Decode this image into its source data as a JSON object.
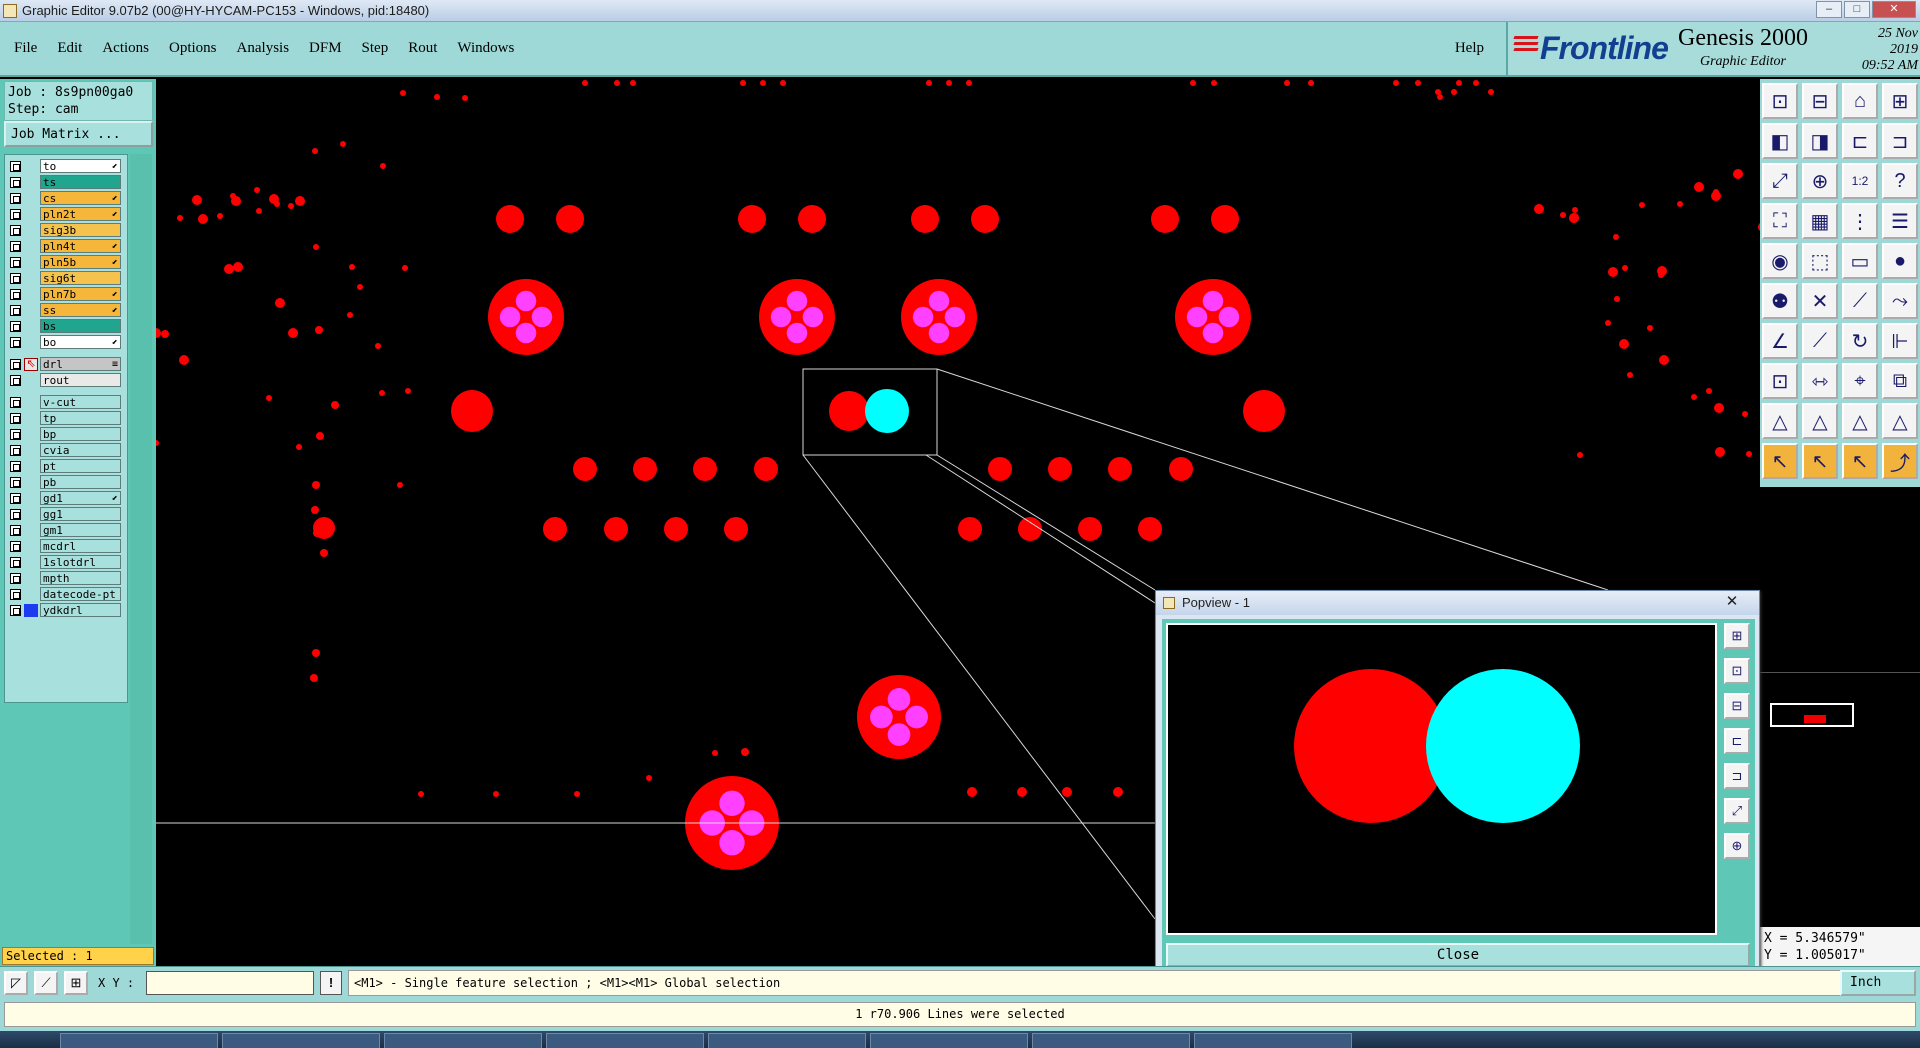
{
  "window": {
    "title": "Graphic Editor 9.07b2 (00@HY-HYCAM-PC153 - Windows, pid:18480)",
    "minimize": "–",
    "maximize": "□",
    "close": "✕"
  },
  "menu": {
    "items": [
      "File",
      "Edit",
      "Actions",
      "Options",
      "Analysis",
      "DFM",
      "Step",
      "Rout",
      "Windows"
    ],
    "help": "Help"
  },
  "brand": {
    "logo": "Frontline",
    "product": "Genesis 2000",
    "subproduct": "Graphic Editor",
    "date": "25 Nov 2019",
    "time": "09:52 AM"
  },
  "job": {
    "job_line": "Job : 8s9pn00ga0",
    "step_line": "Step: cam",
    "matrix_button": "Job Matrix ..."
  },
  "layers": [
    {
      "name": "to",
      "color": "#ffffff",
      "mark": "⬋"
    },
    {
      "name": "ts",
      "color": "#20a58e",
      "mark": ""
    },
    {
      "name": "cs",
      "color": "#f5b63a",
      "mark": "⬋"
    },
    {
      "name": "pln2t",
      "color": "#f5b63a",
      "mark": "⬋"
    },
    {
      "name": "sig3b",
      "color": "#f5c24e",
      "mark": ""
    },
    {
      "name": "pln4t",
      "color": "#f5b63a",
      "mark": "⬋"
    },
    {
      "name": "pln5b",
      "color": "#f5b63a",
      "mark": "⬋"
    },
    {
      "name": "sig6t",
      "color": "#f5c24e",
      "mark": ""
    },
    {
      "name": "pln7b",
      "color": "#f5b63a",
      "mark": "⬋"
    },
    {
      "name": "ss",
      "color": "#f5b63a",
      "mark": "⬋"
    },
    {
      "name": "bs",
      "color": "#20a58e",
      "mark": ""
    },
    {
      "name": "bo",
      "color": "#ffffff",
      "mark": "⬋"
    },
    {
      "name": "drl",
      "color": "#c5c5c5",
      "mark": "≡",
      "sep": true,
      "active": true
    },
    {
      "name": "rout",
      "color": "#e9e9e9",
      "mark": ""
    },
    {
      "name": "v-cut",
      "color": "#a8e0dd",
      "mark": "",
      "sep": true
    },
    {
      "name": "tp",
      "color": "#a8e0dd",
      "mark": ""
    },
    {
      "name": "bp",
      "color": "#a8e0dd",
      "mark": ""
    },
    {
      "name": "cvia",
      "color": "#a8e0dd",
      "mark": ""
    },
    {
      "name": "pt",
      "color": "#a8e0dd",
      "mark": ""
    },
    {
      "name": "pb",
      "color": "#a8e0dd",
      "mark": ""
    },
    {
      "name": "gd1",
      "color": "#a8e0dd",
      "mark": "⬋"
    },
    {
      "name": "gg1",
      "color": "#a8e0dd",
      "mark": ""
    },
    {
      "name": "gm1",
      "color": "#a8e0dd",
      "mark": ""
    },
    {
      "name": "mcdrl",
      "color": "#a8e0dd",
      "mark": ""
    },
    {
      "name": "1slotdrl",
      "color": "#a8e0dd",
      "mark": ""
    },
    {
      "name": "mpth",
      "color": "#a8e0dd",
      "mark": ""
    },
    {
      "name": "datecode-pt",
      "color": "#a8e0dd",
      "mark": ""
    },
    {
      "name": "ydkdrl",
      "color": "#a8e0dd",
      "mark": ""
    }
  ],
  "selected_text": "Selected : 1",
  "colors": {
    "pad": "#ff0000",
    "highlight": "#00ffff",
    "inner": "#ff40ff",
    "panel": "#9fd9d7"
  },
  "popview": {
    "title": "Popview - 1",
    "close_x": "✕",
    "close_button": "Close"
  },
  "coords": {
    "x": "X = 5.346579\"",
    "y": "Y = 1.005017\""
  },
  "command": {
    "xy_label": "X Y :",
    "xy_value": "",
    "info": "!",
    "hint": "<M1> - Single feature selection ; <M1><M1> Global selection",
    "units": "Inch"
  },
  "status": "1 r70.906 Lines were selected",
  "toolbar_icons": [
    "zoom-in-icon",
    "zoom-out-icon",
    "home-icon",
    "split-view-icon",
    "pan-left-icon",
    "pan-right-icon",
    "pan-up-icon",
    "pan-down-icon",
    "fit-all-icon",
    "fit-profile-icon",
    "zoom-1to1-icon",
    "zoom-area-icon",
    "measure-icon",
    "grid-icon",
    "snap-icon",
    "layers-icon",
    "add-pad-icon",
    "add-line-icon",
    "ruler-icon",
    "add-surface-icon",
    "select-feature-icon",
    "delete-icon",
    "connect-icon",
    "break-icon",
    "add-arc-icon",
    "move-icon",
    "rotate-icon",
    "mirror-icon",
    "transform-icon",
    "resize-icon",
    "reshape-icon",
    "copy-icon",
    "triangle-icon",
    "polygon-icon",
    "outline-icon",
    "fill-icon",
    "pointer-icon",
    "pointer-select-icon",
    "pointer-move-icon",
    "route-icon"
  ],
  "popview_tools": [
    "zoom-home-icon",
    "zoom-in-icon",
    "zoom-out-icon",
    "pan-left-icon",
    "pan-right-icon",
    "fit-icon",
    "center-icon"
  ]
}
